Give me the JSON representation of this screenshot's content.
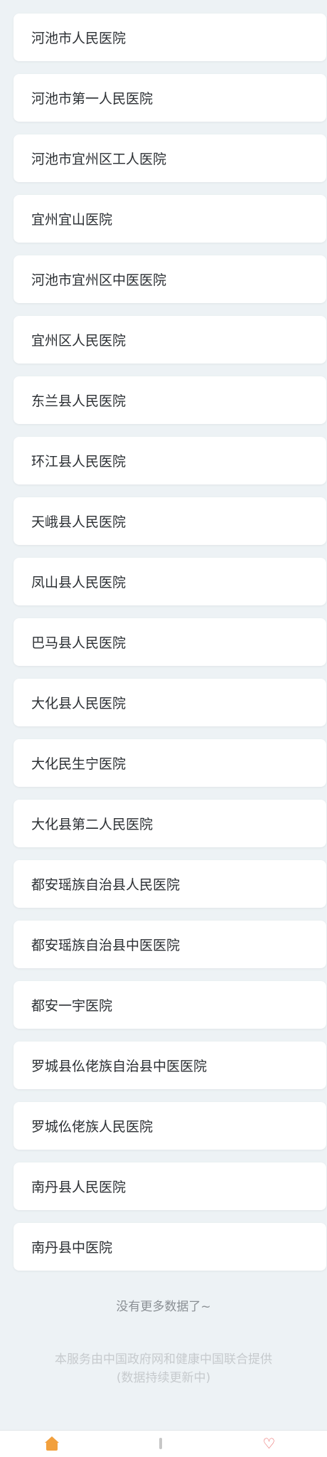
{
  "hospitals": [
    "河池市人民医院",
    "河池市第一人民医院",
    "河池市宜州区工人医院",
    "宜州宜山医院",
    "河池市宜州区中医医院",
    "宜州区人民医院",
    "东兰县人民医院",
    "环江县人民医院",
    "天峨县人民医院",
    "凤山县人民医院",
    "巴马县人民医院",
    "大化县人民医院",
    "大化民生宁医院",
    "大化县第二人民医院",
    "都安瑶族自治县人民医院",
    "都安瑶族自治县中医医院",
    "都安一宇医院",
    "罗城县仫佬族自治县中医医院",
    "罗城仫佬族人民医院",
    "南丹县人民医院",
    "南丹县中医院"
  ],
  "no_more_text": "没有更多数据了~",
  "footer": {
    "line1": "本服务由中国政府网和健康中国联合提供",
    "line2": "(数据持续更新中)"
  },
  "tabbar": {
    "tabs": [
      {
        "label": "",
        "icon": "home-icon"
      },
      {
        "label": "",
        "icon": "list-icon"
      },
      {
        "label": "",
        "icon": "heart-icon"
      }
    ]
  },
  "colors": {
    "background": "#edf2f5",
    "card": "#ffffff",
    "text": "#2b2f33",
    "muted": "#8a8f94",
    "faint": "#c6cacd",
    "accent_home": "#f2a03d",
    "accent_heart": "#e85b5b"
  }
}
